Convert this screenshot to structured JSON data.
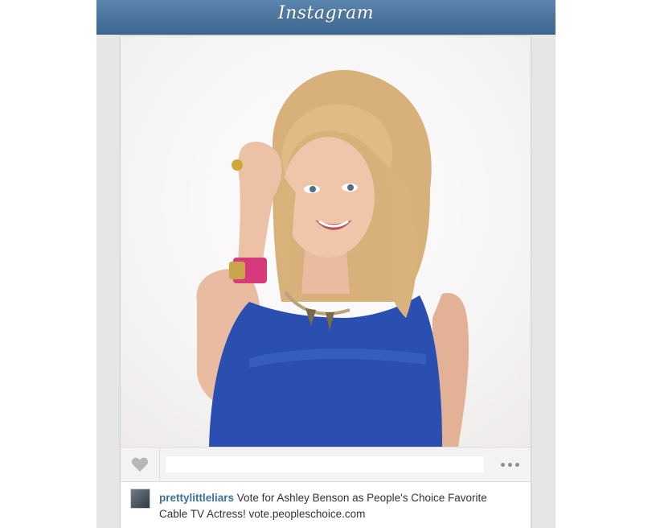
{
  "header": {
    "brand": "Instagram"
  },
  "post": {
    "username": "prettylittleliars",
    "caption": "Vote for Ashley Benson as People's Choice Favorite Cable TV Actress! vote.peopleschoice.com",
    "likes_redacted": true
  },
  "icons": {
    "like": "heart-icon",
    "more": "more-options-icon"
  },
  "colors": {
    "header_bar": "#4b76a0",
    "username": "#3f729b",
    "dress": "#2b4fb0"
  }
}
